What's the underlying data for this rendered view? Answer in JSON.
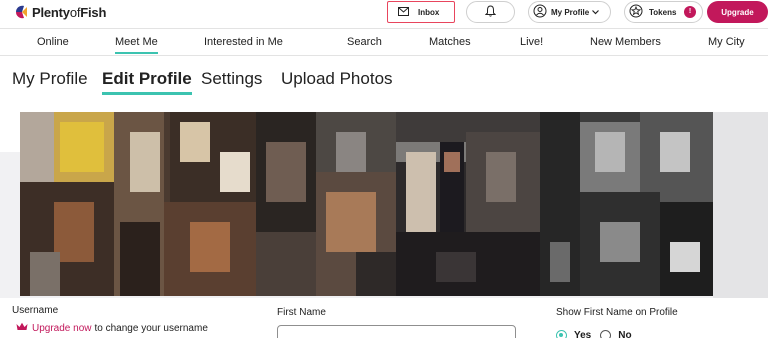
{
  "header": {
    "logo_plenty": "Plenty",
    "logo_of": "of",
    "logo_fish": "Fish",
    "inbox_label": "Inbox",
    "my_profile_label": "My Profile",
    "tokens_label": "Tokens",
    "tokens_badge": "!",
    "upgrade_label": "Upgrade",
    "icons": [
      "mail-icon",
      "bell-icon",
      "user-circle-icon",
      "chevron-down-icon",
      "star-icon"
    ]
  },
  "nav": {
    "items": [
      "Online",
      "Meet Me",
      "Interested in Me",
      "Search",
      "Matches",
      "Live!",
      "New Members",
      "My City"
    ],
    "active": "Meet Me"
  },
  "subtabs": {
    "items": [
      "My Profile",
      "Edit Profile",
      "Settings",
      "Upload Photos"
    ],
    "active": "Edit Profile"
  },
  "form": {
    "username_label": "Username",
    "upgrade_link": "Upgrade now",
    "upgrade_suffix": "to change your username",
    "first_name_label": "First Name",
    "first_name_value": "",
    "show_first_name_label": "Show First Name on Profile",
    "show_first_name_options": [
      "Yes",
      "No"
    ],
    "show_first_name_selected": "Yes"
  },
  "colors": {
    "accent": "#3cc3b0",
    "brand": "#c2185b",
    "inbox_border": "#e8455d"
  }
}
